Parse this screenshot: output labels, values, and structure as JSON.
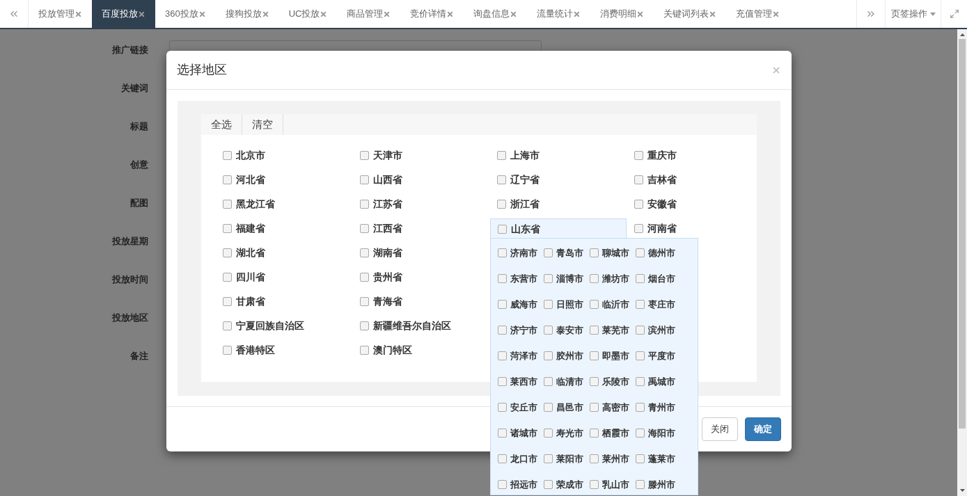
{
  "tabs": [
    {
      "label": "投放管理",
      "selected": false
    },
    {
      "label": "百度投放",
      "selected": true
    },
    {
      "label": "360投放",
      "selected": false
    },
    {
      "label": "搜狗投放",
      "selected": false
    },
    {
      "label": "UC投放",
      "selected": false
    },
    {
      "label": "商品管理",
      "selected": false
    },
    {
      "label": "竞价详情",
      "selected": false
    },
    {
      "label": "询盘信息",
      "selected": false
    },
    {
      "label": "流量统计",
      "selected": false
    },
    {
      "label": "消费明细",
      "selected": false
    },
    {
      "label": "关键词列表",
      "selected": false
    },
    {
      "label": "充值管理",
      "selected": false
    }
  ],
  "tab_actions": {
    "label": "页签操作"
  },
  "form": {
    "fields": [
      {
        "label": "推广链接",
        "kind": "input"
      },
      {
        "label": "关键词",
        "kind": "plain"
      },
      {
        "label": "标题",
        "kind": "plain"
      },
      {
        "label": "创意",
        "kind": "plain"
      },
      {
        "label": "配图",
        "kind": "plain"
      },
      {
        "label": "投放星期",
        "kind": "plain"
      },
      {
        "label": "投放时间",
        "kind": "plain"
      },
      {
        "label": "投放地区",
        "kind": "plain"
      },
      {
        "label": "备注",
        "kind": "plain"
      }
    ]
  },
  "modal": {
    "title": "选择地区",
    "toolbar": [
      {
        "label": "全选"
      },
      {
        "label": "清空"
      }
    ],
    "province_rows": [
      [
        {
          "label": "北京市",
          "checked": false,
          "expanded": false
        },
        {
          "label": "天津市",
          "checked": false,
          "expanded": false
        },
        {
          "label": "上海市",
          "checked": false,
          "expanded": false
        },
        {
          "label": "重庆市",
          "checked": false,
          "expanded": false
        }
      ],
      [
        {
          "label": "河北省",
          "checked": false,
          "expanded": false
        },
        {
          "label": "山西省",
          "checked": false,
          "expanded": false
        },
        {
          "label": "辽宁省",
          "checked": false,
          "expanded": false
        },
        {
          "label": "吉林省",
          "checked": false,
          "expanded": false
        }
      ],
      [
        {
          "label": "黑龙江省",
          "checked": false,
          "expanded": false
        },
        {
          "label": "江苏省",
          "checked": false,
          "expanded": false
        },
        {
          "label": "浙江省",
          "checked": false,
          "expanded": false
        },
        {
          "label": "安徽省",
          "checked": false,
          "expanded": false
        }
      ],
      [
        {
          "label": "福建省",
          "checked": false,
          "expanded": false
        },
        {
          "label": "江西省",
          "checked": false,
          "expanded": false
        },
        {
          "label": "山东省",
          "checked": false,
          "expanded": true
        },
        {
          "label": "河南省",
          "checked": false,
          "expanded": false
        }
      ],
      [
        {
          "label": "湖北省",
          "checked": false,
          "expanded": false
        },
        {
          "label": "湖南省",
          "checked": false,
          "expanded": false
        }
      ],
      [
        {
          "label": "四川省",
          "checked": false,
          "expanded": false
        },
        {
          "label": "贵州省",
          "checked": false,
          "expanded": false
        }
      ],
      [
        {
          "label": "甘肃省",
          "checked": false,
          "expanded": false
        },
        {
          "label": "青海省",
          "checked": false,
          "expanded": false
        }
      ],
      [
        {
          "label": "宁夏回族自治区",
          "checked": false,
          "expanded": false
        },
        {
          "label": "新疆维吾尔自治区",
          "checked": false,
          "expanded": false
        }
      ],
      [
        {
          "label": "香港特区",
          "checked": false,
          "expanded": false
        },
        {
          "label": "澳门特区",
          "checked": false,
          "expanded": false
        }
      ]
    ],
    "cities": [
      {
        "label": "济南市",
        "checked": false
      },
      {
        "label": "青岛市",
        "checked": false
      },
      {
        "label": "聊城市",
        "checked": false
      },
      {
        "label": "德州市",
        "checked": false
      },
      {
        "label": "东营市",
        "checked": false
      },
      {
        "label": "淄博市",
        "checked": false
      },
      {
        "label": "潍坊市",
        "checked": false
      },
      {
        "label": "烟台市",
        "checked": false
      },
      {
        "label": "威海市",
        "checked": false
      },
      {
        "label": "日照市",
        "checked": false
      },
      {
        "label": "临沂市",
        "checked": false
      },
      {
        "label": "枣庄市",
        "checked": false
      },
      {
        "label": "济宁市",
        "checked": false
      },
      {
        "label": "泰安市",
        "checked": false
      },
      {
        "label": "莱芜市",
        "checked": false
      },
      {
        "label": "滨州市",
        "checked": false
      },
      {
        "label": "菏泽市",
        "checked": false
      },
      {
        "label": "胶州市",
        "checked": false
      },
      {
        "label": "即墨市",
        "checked": false
      },
      {
        "label": "平度市",
        "checked": false
      },
      {
        "label": "莱西市",
        "checked": false
      },
      {
        "label": "临清市",
        "checked": false
      },
      {
        "label": "乐陵市",
        "checked": false
      },
      {
        "label": "禹城市",
        "checked": false
      },
      {
        "label": "安丘市",
        "checked": false
      },
      {
        "label": "昌邑市",
        "checked": false
      },
      {
        "label": "高密市",
        "checked": false
      },
      {
        "label": "青州市",
        "checked": false
      },
      {
        "label": "诸城市",
        "checked": false
      },
      {
        "label": "寿光市",
        "checked": false
      },
      {
        "label": "栖霞市",
        "checked": false
      },
      {
        "label": "海阳市",
        "checked": false
      },
      {
        "label": "龙口市",
        "checked": false
      },
      {
        "label": "莱阳市",
        "checked": false
      },
      {
        "label": "莱州市",
        "checked": false
      },
      {
        "label": "蓬莱市",
        "checked": false
      },
      {
        "label": "招远市",
        "checked": false
      },
      {
        "label": "荣成市",
        "checked": false
      },
      {
        "label": "乳山市",
        "checked": false
      },
      {
        "label": "滕州市",
        "checked": false
      }
    ],
    "buttons": [
      {
        "label": "关闭",
        "kind": "default"
      },
      {
        "label": "确定",
        "kind": "primary"
      }
    ]
  }
}
